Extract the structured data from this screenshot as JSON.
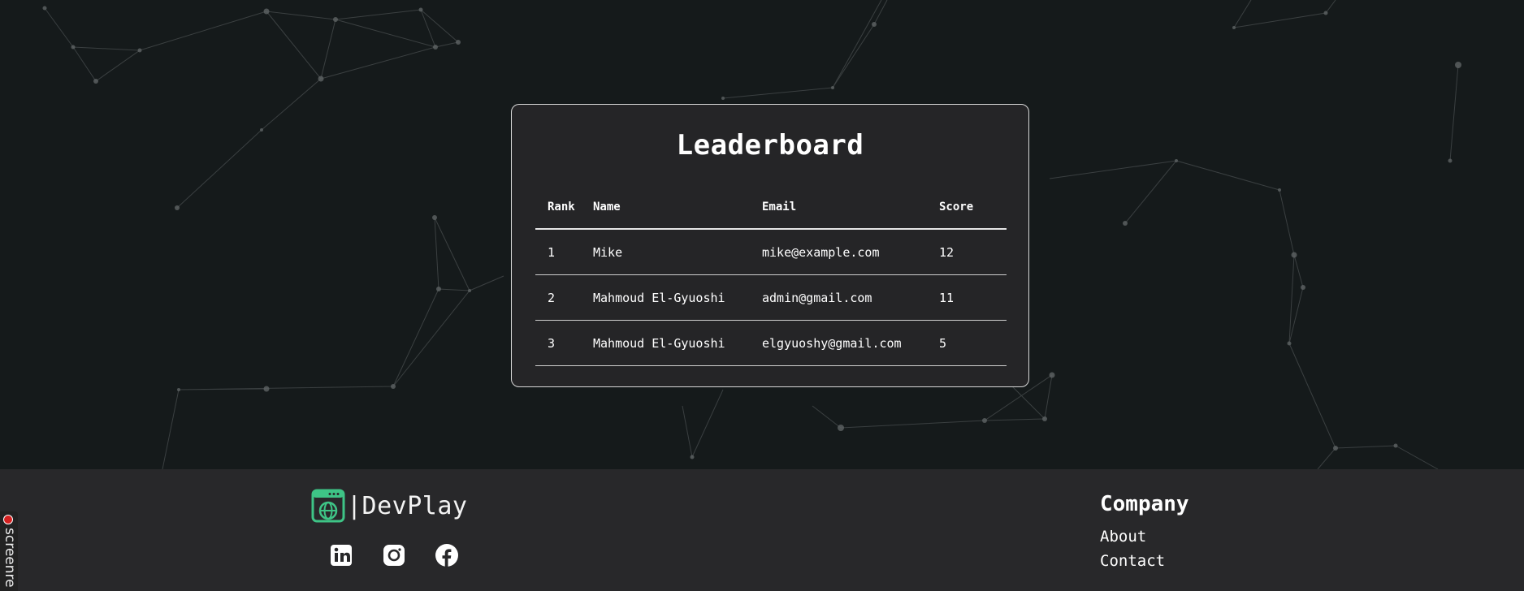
{
  "leaderboard": {
    "title": "Leaderboard",
    "columns": [
      "Rank",
      "Name",
      "Email",
      "Score"
    ],
    "rows": [
      {
        "rank": "1",
        "name": "Mike",
        "email": "mike@example.com",
        "score": "12"
      },
      {
        "rank": "2",
        "name": "Mahmoud El-Gyuoshi",
        "email": "admin@gmail.com",
        "score": "11"
      },
      {
        "rank": "3",
        "name": "Mahmoud El-Gyuoshi",
        "email": "elgyuoshy@gmail.com",
        "score": "5"
      }
    ]
  },
  "footer": {
    "brand": "|DevPlay",
    "socials": [
      "linkedin-icon",
      "instagram-icon",
      "facebook-icon"
    ],
    "company": {
      "heading": "Company",
      "links": [
        "About",
        "Contact"
      ]
    }
  },
  "recorder": {
    "label": "screenre"
  },
  "colors": {
    "background": "#151a1b",
    "card": "#252527",
    "footer": "#28282a",
    "logo_green": "#3ec486"
  }
}
